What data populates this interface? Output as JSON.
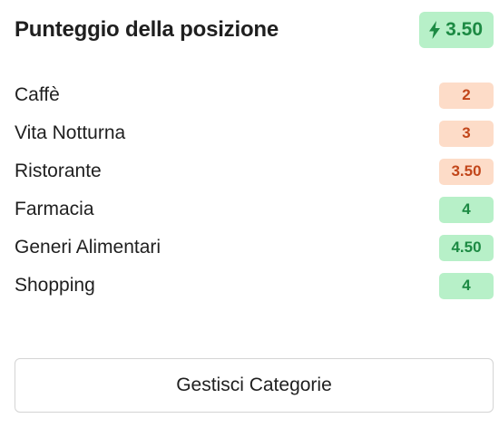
{
  "header": {
    "title": "Punteggio della posizione",
    "total_score": "3.50",
    "total_icon": "lightning-bolt-icon",
    "total_color": "#1c8a43",
    "total_bg": "#b7f0c8"
  },
  "categories": [
    {
      "label": "Caffè",
      "score": "2",
      "tone": "orange"
    },
    {
      "label": "Vita Notturna",
      "score": "3",
      "tone": "orange"
    },
    {
      "label": "Ristorante",
      "score": "3.50",
      "tone": "orange"
    },
    {
      "label": "Farmacia",
      "score": "4",
      "tone": "green"
    },
    {
      "label": "Generi Alimentari",
      "score": "4.50",
      "tone": "green"
    },
    {
      "label": "Shopping",
      "score": "4",
      "tone": "green"
    }
  ],
  "colors": {
    "orange_bg": "#fddcc8",
    "orange_text": "#c2461a",
    "green_bg": "#b7f0c8",
    "green_text": "#1c8a43"
  },
  "actions": {
    "manage_label": "Gestisci Categorie"
  }
}
